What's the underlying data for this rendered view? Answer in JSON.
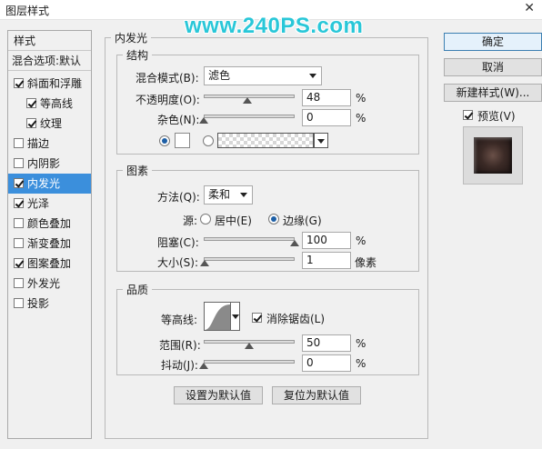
{
  "window": {
    "title": "图层样式",
    "close_glyph": "✕"
  },
  "watermark": "www.240PS.com",
  "sidebar": {
    "header": "样式",
    "blend_options": "混合选项:默认",
    "items": [
      {
        "label": "斜面和浮雕",
        "checked": true
      },
      {
        "label": "等高线",
        "checked": true
      },
      {
        "label": "纹理",
        "checked": true
      },
      {
        "label": "描边",
        "checked": false
      },
      {
        "label": "内阴影",
        "checked": false
      },
      {
        "label": "内发光",
        "checked": true,
        "selected": true
      },
      {
        "label": "光泽",
        "checked": true
      },
      {
        "label": "颜色叠加",
        "checked": false
      },
      {
        "label": "渐变叠加",
        "checked": false
      },
      {
        "label": "图案叠加",
        "checked": true
      },
      {
        "label": "外发光",
        "checked": false
      },
      {
        "label": "投影",
        "checked": false
      }
    ]
  },
  "panel": {
    "title": "内发光",
    "structure": {
      "title": "结构",
      "blend_mode_label": "混合模式(B):",
      "blend_mode_value": "滤色",
      "opacity_label": "不透明度(O):",
      "opacity_value": "48",
      "opacity_level": 0.48,
      "noise_label": "杂色(N):",
      "noise_value": "0",
      "noise_level": 0.0,
      "percent": "%",
      "glow_color": "#ffffff"
    },
    "elements": {
      "title": "图素",
      "method_label": "方法(Q):",
      "method_value": "柔和",
      "source_label": "源:",
      "source_center": "居中(E)",
      "source_edge": "边缘(G)",
      "choke_label": "阻塞(C):",
      "choke_value": "100",
      "choke_level": 1.0,
      "size_label": "大小(S):",
      "size_value": "1",
      "size_unit": "像素",
      "percent": "%"
    },
    "quality": {
      "title": "品质",
      "contour_label": "等高线:",
      "antialias_label": "消除锯齿(L)",
      "range_label": "范围(R):",
      "range_value": "50",
      "range_level": 0.5,
      "jitter_label": "抖动(J):",
      "jitter_value": "0",
      "jitter_level": 0.0,
      "percent": "%"
    },
    "set_default": "设置为默认值",
    "reset_default": "复位为默认值"
  },
  "right": {
    "ok": "确定",
    "cancel": "取消",
    "new_style": "新建样式(W)...",
    "preview": "预览(V)"
  }
}
